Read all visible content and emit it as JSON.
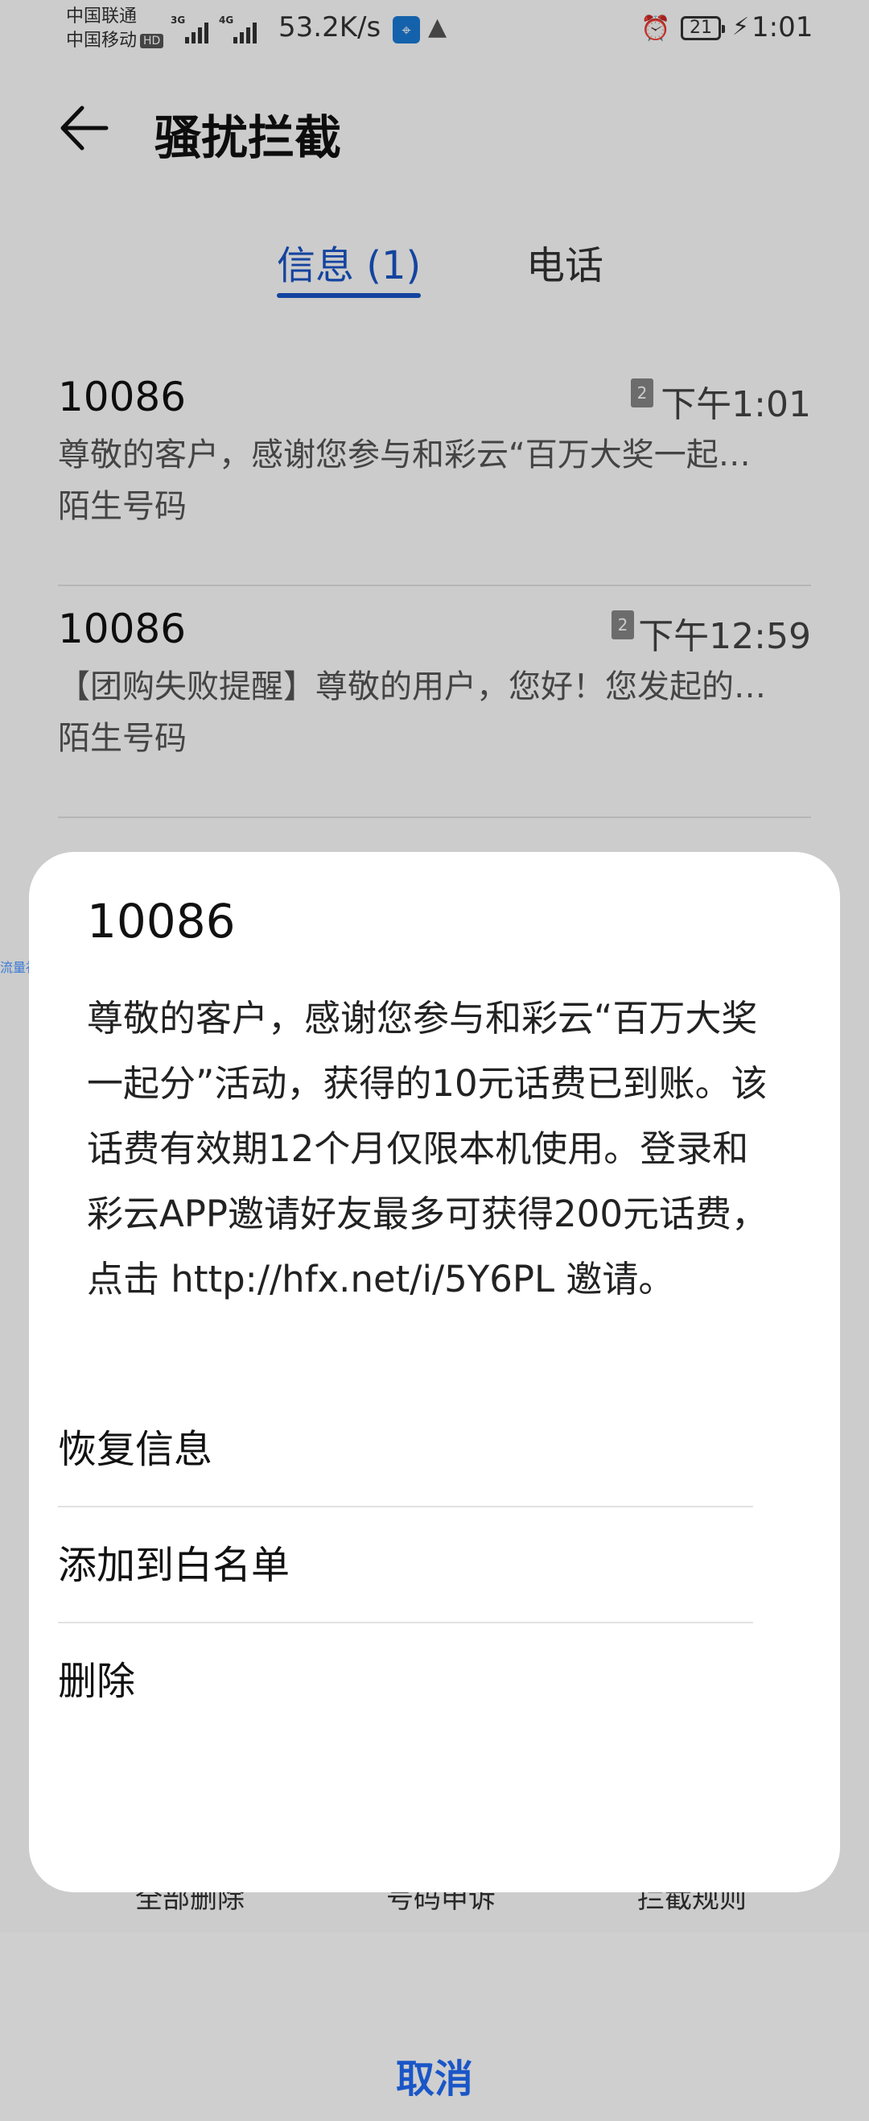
{
  "status_bar": {
    "carrier_1": "中国联通",
    "carrier_2": "中国移动",
    "hd": "HD",
    "net_1": "3G",
    "net_2": "4G",
    "speed": "53.2K/s",
    "battery": "21",
    "time": "1:01"
  },
  "header": {
    "title": "骚扰拦截"
  },
  "tabs": [
    {
      "label": "信息 (1)",
      "active": true
    },
    {
      "label": "电话",
      "active": false
    }
  ],
  "messages": [
    {
      "sender": "10086",
      "sim": "2",
      "time": "下午1:01",
      "preview": "尊敬的客户，感谢您参与和彩云“百万大奖一起…",
      "tag": "陌生号码"
    },
    {
      "sender": "10086",
      "sim": "2",
      "time": "下午12:59",
      "preview": "【团购失败提醒】尊敬的用户，您好！您发起的…",
      "tag": "陌生号码"
    }
  ],
  "toolbar": {
    "delete_all": "全部删除",
    "appeal": "号码申诉",
    "rules": "拦截规则"
  },
  "watermark": "流量社区",
  "sheet": {
    "title": "10086",
    "body": "尊敬的客户，感谢您参与和彩云“百万大奖一起分”活动，获得的10元话费已到账。该话费有效期12个月仅限本机使用。登录和彩云APP邀请好友最多可获得200元话费，点击 http://hfx.net/i/5Y6PL 邀请。",
    "actions": {
      "restore": "恢复信息",
      "whitelist": "添加到白名单",
      "delete": "删除"
    },
    "cancel": "取消"
  },
  "colors": {
    "accent": "#1a56c7"
  }
}
